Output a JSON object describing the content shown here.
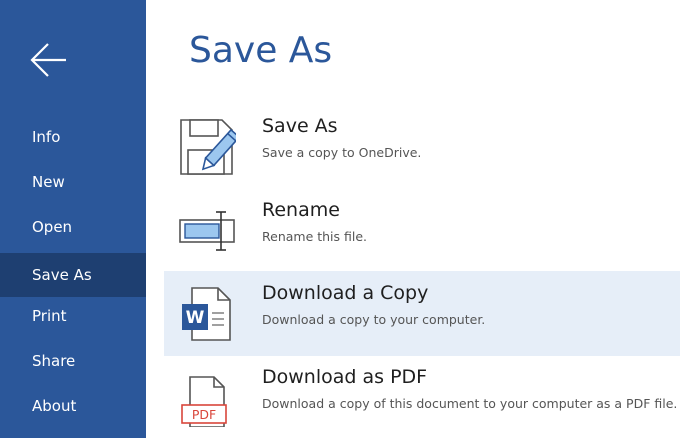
{
  "sidebar": {
    "items": [
      {
        "label": "Info"
      },
      {
        "label": "New"
      },
      {
        "label": "Open"
      },
      {
        "label": "Save As",
        "active": true
      },
      {
        "label": "Print"
      },
      {
        "label": "Share"
      },
      {
        "label": "About"
      }
    ]
  },
  "main": {
    "title": "Save As",
    "options": [
      {
        "title": "Save As",
        "description": "Save a copy to OneDrive.",
        "icon": "save-disk-pencil-icon"
      },
      {
        "title": "Rename",
        "description": "Rename this file.",
        "icon": "rename-field-icon"
      },
      {
        "title": "Download a Copy",
        "description": "Download a copy to your computer.",
        "icon": "word-document-icon",
        "highlighted": true
      },
      {
        "title": "Download as PDF",
        "description": "Download a copy of this document to your computer as a PDF file.",
        "icon": "pdf-document-icon",
        "badge": "PDF"
      }
    ]
  },
  "colors": {
    "sidebar": "#2b579a",
    "sidebar_active": "#1e3f71",
    "title": "#2b579a",
    "highlight": "#e6eef8",
    "icon_blue": "#2b579a",
    "rename_fill": "#9cc7ef",
    "pdf_red": "#d9463b"
  }
}
